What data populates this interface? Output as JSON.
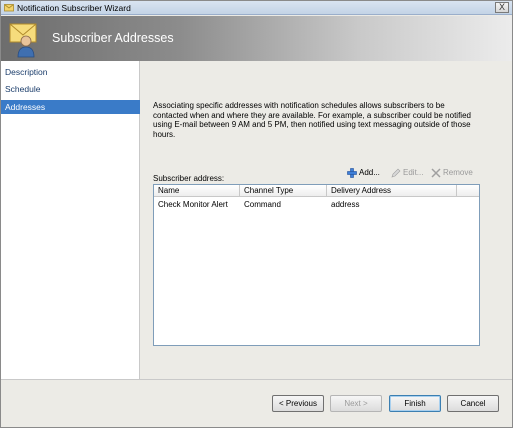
{
  "window": {
    "title": "Notification Subscriber Wizard",
    "close_glyph": "X"
  },
  "header": {
    "title": "Subscriber Addresses",
    "icon": "envelope-user-icon"
  },
  "nav": {
    "items": [
      {
        "label": "Description",
        "selected": false
      },
      {
        "label": "Schedule",
        "selected": false
      },
      {
        "label": "Addresses",
        "selected": true
      }
    ]
  },
  "content": {
    "description": "Associating specific addresses with notification schedules allows subscribers to be contacted when and where they are available. For example, a subscriber could be notified using E-mail between 9 AM and 5 PM, then notified using text messaging outside of those hours.",
    "address_label": "Subscriber address:",
    "toolbar": {
      "add_label": "Add...",
      "edit_label": "Edit...",
      "remove_label": "Remove"
    },
    "table": {
      "columns": [
        "Name",
        "Channel Type",
        "Delivery Address"
      ],
      "rows": [
        [
          "Check Monitor Alert",
          "Command",
          "address"
        ]
      ]
    }
  },
  "footer": {
    "previous_label": "< Previous",
    "next_label": "Next >",
    "finish_label": "Finish",
    "cancel_label": "Cancel"
  },
  "colors": {
    "selection": "#3a7bc8",
    "nav_text": "#1b3d6b",
    "panel": "#ecebe6"
  }
}
